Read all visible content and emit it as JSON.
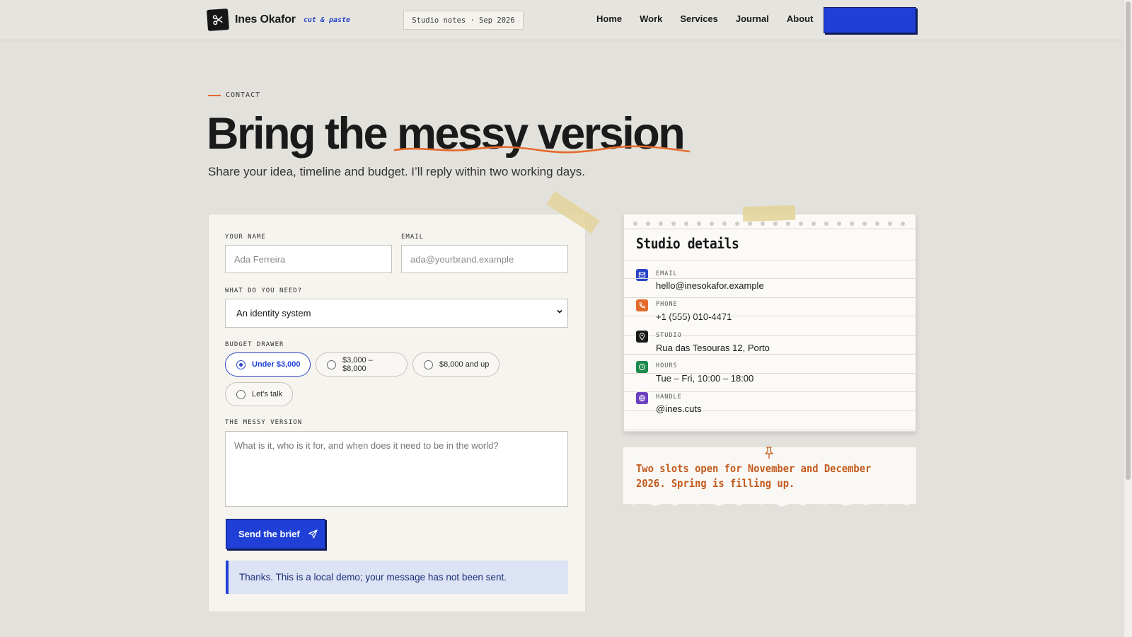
{
  "header": {
    "brand_name": "Ines Okafor",
    "brand_tag": "cut & paste",
    "notes_pill": "Studio notes · Sep 2026",
    "nav": [
      "Home",
      "Work",
      "Services",
      "Journal",
      "About"
    ],
    "cta_label": ""
  },
  "hero": {
    "eyebrow": "CONTACT",
    "headline_start": "Bring the ",
    "headline_highlight": "messy version",
    "lede": "Share your idea, timeline and budget. I’ll reply within two working days."
  },
  "form": {
    "name_label": "YOUR NAME",
    "name_placeholder": "Ada Ferreira",
    "email_label": "EMAIL",
    "email_placeholder": "ada@yourbrand.example",
    "need_label": "WHAT DO YOU NEED?",
    "need_selected": "An identity system",
    "budget_label": "BUDGET DRAWER",
    "budget_options": [
      "Under $3,000",
      "$3,000 – $8,000",
      "$8,000 and up",
      "Let's talk"
    ],
    "budget_selected": "Under $3,000",
    "message_label": "THE MESSY VERSION",
    "message_placeholder": "What is it, who is it for, and when does it need to be in the world?",
    "send_label": "Send the brief",
    "notice": "Thanks. This is a local demo; your message has not been sent."
  },
  "studio": {
    "title": "Studio details",
    "rows": [
      {
        "label": "EMAIL",
        "value": "hello@inesokafor.example",
        "icon": "mail-icon",
        "color": "#2a45c8"
      },
      {
        "label": "PHONE",
        "value": "+1 (555) 010-4471",
        "icon": "phone-icon",
        "color": "#e46a2b"
      },
      {
        "label": "STUDIO",
        "value": "Rua das Tesouras 12, Porto",
        "icon": "location-pin-icon",
        "color": "#1a1a1a"
      },
      {
        "label": "HOURS",
        "value": "Tue – Fri, 10:00 – 18:00",
        "icon": "clock-icon",
        "color": "#1e8a4c"
      },
      {
        "label": "HANDLE",
        "value": "@ines.cuts",
        "icon": "globe-icon",
        "color": "#6b3fc0"
      }
    ]
  },
  "sticky": {
    "text": "Two slots open for November and December 2026. Spring is filling up."
  },
  "colors": {
    "accent": "#1f3fd6",
    "highlight": "#e46a2b",
    "background": "#e3e1dc"
  }
}
